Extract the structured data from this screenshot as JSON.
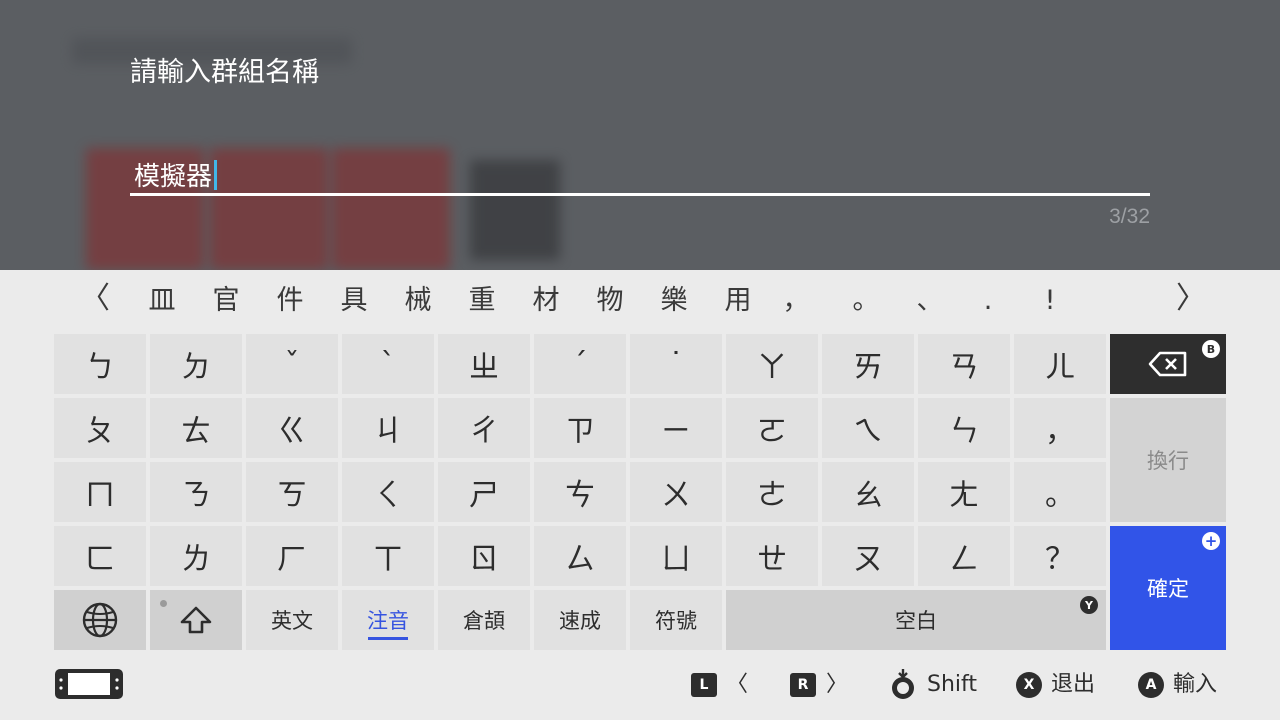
{
  "dialog": {
    "prompt": "請輸入群組名稱",
    "input_value": "模擬器",
    "char_count": "3/32"
  },
  "candidates": {
    "items": [
      "皿",
      "官",
      "件",
      "具",
      "械",
      "重",
      "材",
      "物",
      "樂",
      "用",
      "，",
      "。",
      "、",
      ".",
      "!"
    ],
    "prev_label": "〈",
    "next_label": "〉"
  },
  "keys": {
    "row1": [
      "ㄅ",
      "ㄉ",
      "ˇ",
      "ˋ",
      "ㄓ",
      "ˊ",
      "˙",
      "ㄚ",
      "ㄞ",
      "ㄢ",
      "ㄦ"
    ],
    "row2": [
      "ㄆ",
      "ㄊ",
      "ㄍ",
      "ㄐ",
      "ㄔ",
      "ㄗ",
      "ㄧ",
      "ㄛ",
      "ㄟ",
      "ㄣ",
      "，"
    ],
    "row3": [
      "ㄇ",
      "ㄋ",
      "ㄎ",
      "ㄑ",
      "ㄕ",
      "ㄘ",
      "ㄨ",
      "ㄜ",
      "ㄠ",
      "ㄤ",
      "。"
    ],
    "row4": [
      "ㄈ",
      "ㄌ",
      "ㄏ",
      "ㄒ",
      "ㄖ",
      "ㄙ",
      "ㄩ",
      "ㄝ",
      "ㄡ",
      "ㄥ",
      "？"
    ]
  },
  "bottom_row": {
    "lang_english": "英文",
    "lang_zhuyin": "注音",
    "lang_cangjie": "倉頡",
    "lang_quick": "速成",
    "symbols": "符號",
    "space": "空白",
    "space_badge": "Y"
  },
  "side_keys": {
    "backspace_badge": "B",
    "newline": "換行",
    "confirm": "確定",
    "confirm_badge": "+"
  },
  "footer": {
    "l_button": "L",
    "l_label": "〈",
    "r_button": "R",
    "r_label": "〉",
    "shift_label": "Shift",
    "x_button": "X",
    "x_label": "退出",
    "a_button": "A",
    "a_label": "輸入"
  },
  "colors": {
    "accent_blue": "#3154e8",
    "caret": "#41b7e9",
    "panel_bg": "#ebebeb",
    "key_bg": "#e1e1e1"
  }
}
